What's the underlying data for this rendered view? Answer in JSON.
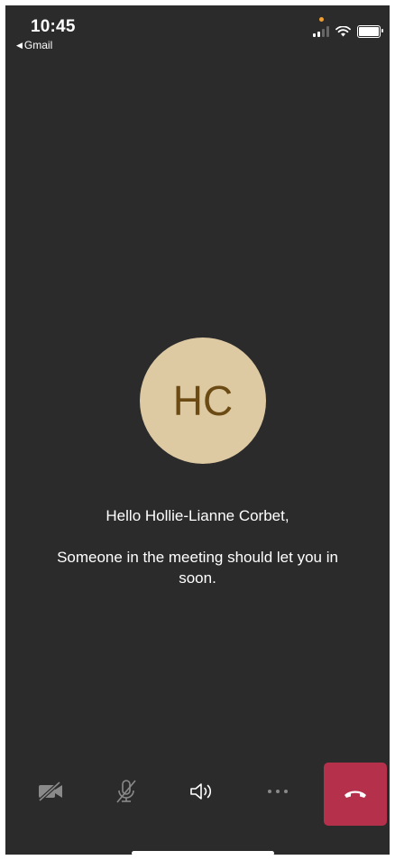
{
  "status_bar": {
    "time": "10:45",
    "back_app": "Gmail",
    "icons": [
      "signal-icon",
      "wifi-icon",
      "battery-icon"
    ]
  },
  "participant": {
    "initials": "HC",
    "avatar_color": "#ddc9a2",
    "initials_color": "#6b4a13"
  },
  "lobby": {
    "greeting": "Hello Hollie-Lianne Corbet,",
    "message": "Someone in the meeting should let you in soon."
  },
  "controls": {
    "items": [
      {
        "icon": "camera-off-icon"
      },
      {
        "icon": "mic-off-icon"
      },
      {
        "icon": "speaker-icon"
      },
      {
        "icon": "more-options-icon"
      },
      {
        "icon": "end-call-icon",
        "color": "#b5304b"
      }
    ]
  },
  "colors": {
    "background": "#2b2b2b",
    "text": "#ffffff",
    "icon_dim": "#8a8a8a"
  }
}
